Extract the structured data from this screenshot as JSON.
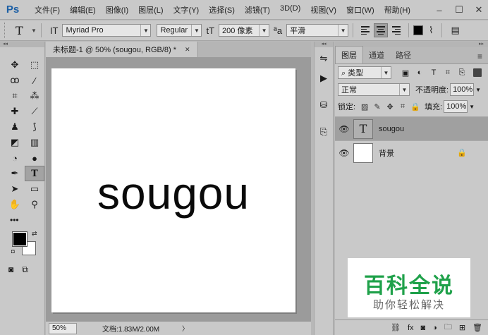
{
  "app": {
    "logo": "Ps"
  },
  "menu": [
    "文件(F)",
    "编辑(E)",
    "图像(I)",
    "图层(L)",
    "文字(Y)",
    "选择(S)",
    "滤镜(T)",
    "3D(D)",
    "视图(V)",
    "窗口(W)",
    "帮助(H)"
  ],
  "window_controls": {
    "minimize": "–",
    "restore": "☐",
    "close": "✕"
  },
  "options": {
    "tool_glyph": "T",
    "orient_glyph": "IT",
    "font_family": "Myriad Pro",
    "font_style": "Regular",
    "size_glyph": "tT",
    "font_size": "200 像素",
    "aa_glyph": "ªa",
    "antialias": "平滑",
    "text_color": "#000000"
  },
  "document": {
    "tab_title": "未标题-1 @ 50% (sougou, RGB/8) *",
    "close_glyph": "✕",
    "canvas_text": "sougou",
    "zoom": "50%",
    "doc_size": "文档:1.83M/2.00M",
    "status_arrow": "〉"
  },
  "toolbar": {
    "tools": [
      {
        "name": "move-tool",
        "glyph": "✥"
      },
      {
        "name": "marquee-tool",
        "glyph": "⬚"
      },
      {
        "name": "lasso-tool",
        "glyph": "ꝏ"
      },
      {
        "name": "magic-wand-tool",
        "glyph": "⁄"
      },
      {
        "name": "crop-tool",
        "glyph": "⌗"
      },
      {
        "name": "eyedropper-tool",
        "glyph": "⁂"
      },
      {
        "name": "healing-brush-tool",
        "glyph": "✚"
      },
      {
        "name": "brush-tool",
        "glyph": "⟋"
      },
      {
        "name": "clone-stamp-tool",
        "glyph": "♟"
      },
      {
        "name": "history-brush-tool",
        "glyph": "⟆"
      },
      {
        "name": "eraser-tool",
        "glyph": "◩"
      },
      {
        "name": "gradient-tool",
        "glyph": "▥"
      },
      {
        "name": "blur-tool",
        "glyph": "◔"
      },
      {
        "name": "dodge-tool",
        "glyph": "●"
      },
      {
        "name": "pen-tool",
        "glyph": "✒"
      },
      {
        "name": "type-tool",
        "glyph": "T"
      },
      {
        "name": "path-selection-tool",
        "glyph": "➤"
      },
      {
        "name": "rectangle-tool",
        "glyph": "▭"
      },
      {
        "name": "hand-tool",
        "glyph": "✋"
      },
      {
        "name": "zoom-tool",
        "glyph": "⚲"
      }
    ],
    "more": "•••",
    "swap_glyph": "⇄",
    "default_glyph": "◘",
    "quick_mask_glyph": "◙",
    "screen_mode_glyph": "⧉",
    "fg_color": "#000000",
    "bg_color": "#ffffff"
  },
  "mid_panel": {
    "buttons": [
      "⇋",
      "▶",
      "⛁",
      "⎘"
    ]
  },
  "layers_panel": {
    "tabs": [
      "图层",
      "通道",
      "路径"
    ],
    "menu_glyph": "≡",
    "filter_label": "⌕ 类型",
    "filter_icons": [
      "▣",
      "◐",
      "T",
      "⌗",
      "⎘"
    ],
    "blend_mode": "正常",
    "opacity_label": "不透明度:",
    "opacity": "100%",
    "lock_label": "锁定:",
    "lock_icons": [
      "▨",
      "✎",
      "✥",
      "⌗",
      "🔒"
    ],
    "fill_label": "填充:",
    "fill": "100%",
    "layers": [
      {
        "name": "sougou",
        "thumb": "T",
        "eye": "👁"
      },
      {
        "name": "背景",
        "thumb": "",
        "eye": "👁",
        "lock": "🔒"
      }
    ],
    "footer_icons": [
      "⛓",
      "fx",
      "◙",
      "◑",
      "🗀",
      "⊞",
      "🗑"
    ]
  },
  "watermark": {
    "title": "百科全说",
    "subtitle": "助你轻松解决"
  }
}
